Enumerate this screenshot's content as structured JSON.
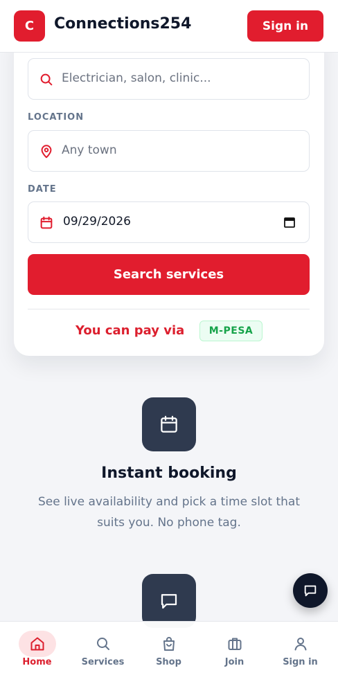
{
  "header": {
    "logo_letter": "C",
    "app_title": "Connections254",
    "signin_label": "Sign in"
  },
  "search": {
    "service_placeholder": "Electrician, salon, clinic...",
    "location_label": "LOCATION",
    "location_placeholder": "Any town",
    "date_label": "DATE",
    "date_value": "09/29/2026",
    "search_button_label": "Search services",
    "pay_text": "You can pay via",
    "pay_badge": "M-PESA"
  },
  "features": [
    {
      "icon": "calendar-icon",
      "title": "Instant booking",
      "description": "See live availability and pick a time slot that suits you. No phone tag."
    },
    {
      "icon": "chat-icon"
    }
  ],
  "bottom_nav": [
    {
      "label": "Home",
      "icon": "home-icon",
      "active": true
    },
    {
      "label": "Services",
      "icon": "search-icon",
      "active": false
    },
    {
      "label": "Shop",
      "icon": "shopping-bag-icon",
      "active": false
    },
    {
      "label": "Join",
      "icon": "briefcase-icon",
      "active": false
    },
    {
      "label": "Sign in",
      "icon": "user-icon",
      "active": false
    }
  ],
  "colors": {
    "brand_red": "#e11d2e",
    "dark_navy": "#0f172a",
    "feature_icon_bg": "#2f3a4f",
    "mpesa_green": "#16a34a"
  }
}
